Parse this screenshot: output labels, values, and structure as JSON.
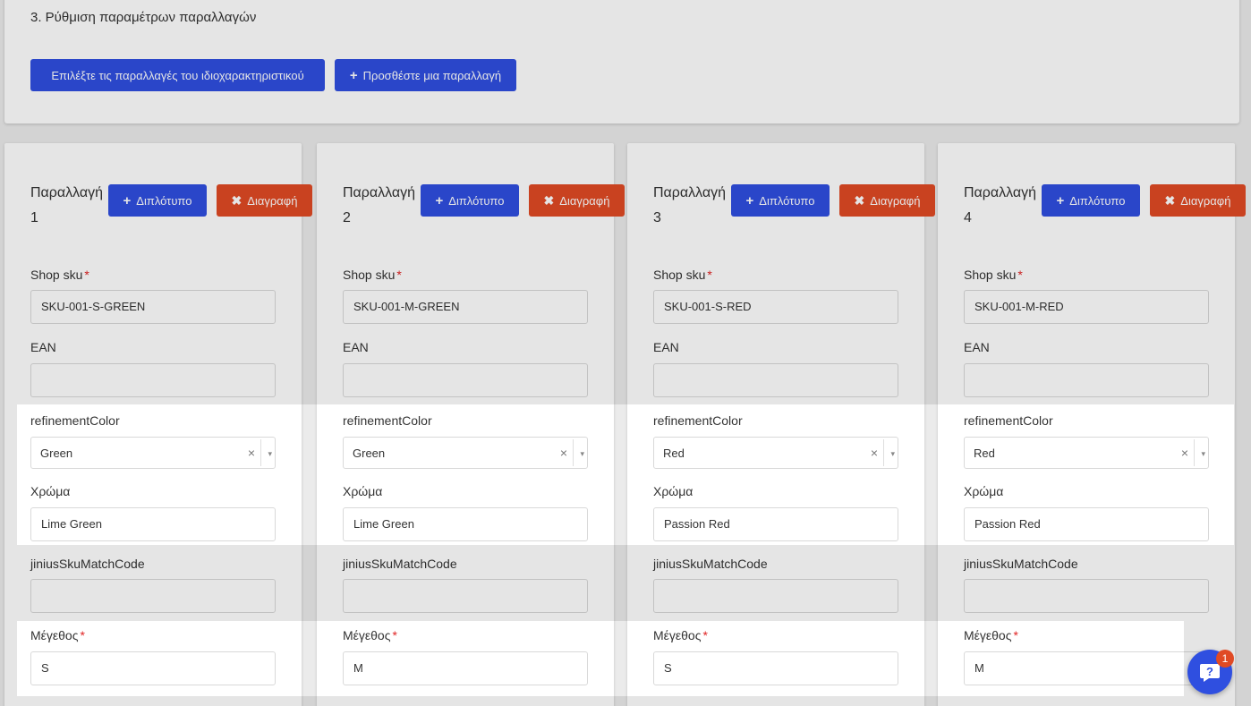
{
  "section": {
    "title": "3. Ρύθμιση παραμέτρων παραλλαγών",
    "select_variations_label": "Επιλέξτε τις παραλλαγές του ιδιοχαρακτηριστικού",
    "add_variation_label": "Προσθέστε μια παραλλαγή"
  },
  "labels": {
    "variation": "Παραλλαγή",
    "duplicate": "Διπλότυπο",
    "delete": "Διαγραφή",
    "shop_sku": "Shop sku",
    "ean": "EAN",
    "refinement_color": "refinementColor",
    "color": "Χρώμα",
    "jinius_sku": "jiniusSkuMatchCode",
    "size": "Μέγεθος",
    "required_mark": "*",
    "clear_glyph": "×",
    "arrow_glyph": "▾",
    "plus_glyph": "+",
    "x_glyph": "✖"
  },
  "variations": [
    {
      "number": "1",
      "shop_sku": "SKU-001-S-GREEN",
      "ean": "",
      "refinement_color": "Green",
      "color": "Lime Green",
      "jinius_sku": "",
      "size": "S"
    },
    {
      "number": "2",
      "shop_sku": "SKU-001-M-GREEN",
      "ean": "",
      "refinement_color": "Green",
      "color": "Lime Green",
      "jinius_sku": "",
      "size": "M"
    },
    {
      "number": "3",
      "shop_sku": "SKU-001-S-RED",
      "ean": "",
      "refinement_color": "Red",
      "color": "Passion Red",
      "jinius_sku": "",
      "size": "S"
    },
    {
      "number": "4",
      "shop_sku": "SKU-001-M-RED",
      "ean": "",
      "refinement_color": "Red",
      "color": "Passion Red",
      "jinius_sku": "",
      "size": "M"
    }
  ],
  "chat": {
    "badge_count": "1",
    "icon": "help-chat-icon"
  },
  "colors": {
    "primary": "#2f4fe0",
    "danger": "#e04a24"
  }
}
